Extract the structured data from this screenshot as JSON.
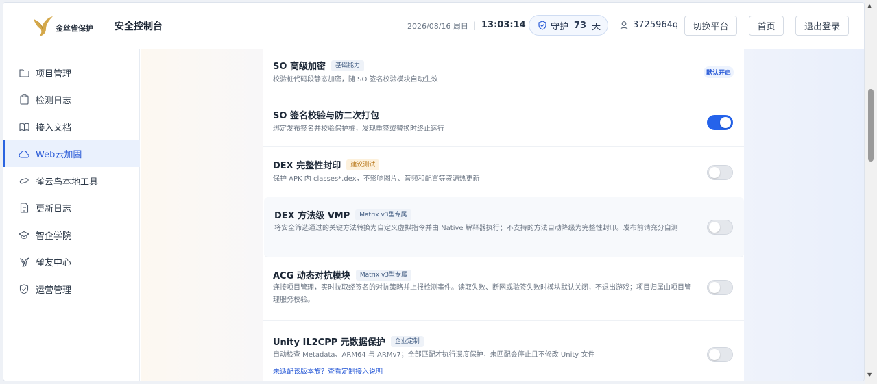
{
  "header": {
    "logo_text": "金丝雀保护",
    "console_title": "安全控制台",
    "date": "2026/08/16 周日",
    "separator": "|",
    "time": "13:03:14",
    "guard_prefix": "守护",
    "guard_days": "73",
    "guard_suffix": "天",
    "username": "3725964q",
    "buttons": {
      "switch": "切换平台",
      "home": "首页",
      "logout": "退出登录"
    }
  },
  "sidebar": {
    "items": [
      {
        "label": "项目管理",
        "icon": "folder-icon"
      },
      {
        "label": "检测日志",
        "icon": "clipboard-icon"
      },
      {
        "label": "接入文档",
        "icon": "book-icon"
      },
      {
        "label": "Web云加固",
        "icon": "cloud-icon",
        "active": true
      },
      {
        "label": "雀云鸟本地工具",
        "icon": "link-icon"
      },
      {
        "label": "更新日志",
        "icon": "document-icon"
      },
      {
        "label": "智企学院",
        "icon": "graduation-cap-icon"
      },
      {
        "label": "雀友中心",
        "icon": "bird-icon"
      },
      {
        "label": "运营管理",
        "icon": "shield-check-icon"
      }
    ]
  },
  "features": [
    {
      "title": "SO 高级加密",
      "tag": "基础能力",
      "desc": "校验桩代码段静态加密，随 SO 签名校验模块自动生效",
      "badge": "默认开启"
    },
    {
      "title": "SO 签名校验与防二次打包",
      "desc": "绑定发布签名并校验保护桩，发现重签或替换时终止运行",
      "enabled": true
    },
    {
      "title": "DEX 完整性封印",
      "tag": "建议测试",
      "desc": "保护 APK 内 classes*.dex，不影响图片、音频和配置等资源热更新",
      "enabled": false
    },
    {
      "title": "DEX 方法级 VMP",
      "tag": "Matrix v3型专属",
      "desc": "将安全筛选通过的关键方法转换为自定义虚拟指令并由 Native 解释器执行；不支持的方法自动降级为完整性封印。发布前请充分自测",
      "enabled": false
    },
    {
      "title": "ACG 动态对抗模块",
      "tag": "Matrix v3型专属",
      "desc": "连接项目管理，实时拉取经签名的对抗策略并上报检测事件。读取失败、断网或验签失败时模块默认关闭，不退出游戏；项目归属由项目管理服务校验。",
      "enabled": false
    },
    {
      "title": "Unity IL2CPP 元数据保护",
      "tag": "企业定制",
      "desc": "自动检查 Metadata、ARM64 与 ARMv7；全部匹配才执行深度保护，未匹配会停止且不修改 Unity 文件",
      "link": "未适配该版本族？查看定制接入说明",
      "enabled": false
    }
  ],
  "colors": {
    "accent": "#2563eb",
    "active_nav_bg": "#eaf1fd"
  }
}
